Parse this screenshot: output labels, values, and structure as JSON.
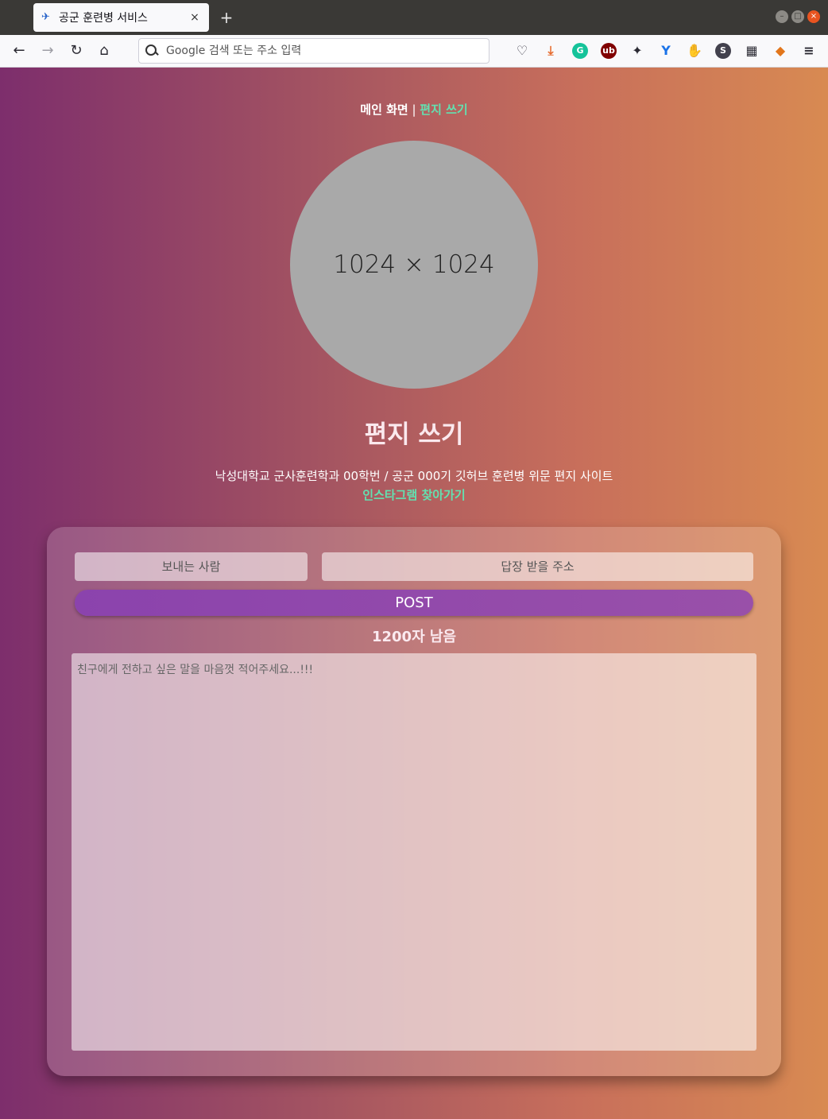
{
  "browser": {
    "tab_title": "공군 훈련병 서비스",
    "tab_close": "×",
    "new_tab": "+",
    "address_placeholder": "Google 검색 또는 주소 입력",
    "nav": {
      "back": "←",
      "forward": "→",
      "reload": "↻",
      "home": "⌂"
    },
    "extensions": [
      {
        "name": "pocket-icon",
        "label": "♡",
        "color": "#42414d"
      },
      {
        "name": "download-icon",
        "label": "⤓",
        "color": "#e66a2c"
      },
      {
        "name": "grammarly-icon",
        "label": "G",
        "color": "#15c39a"
      },
      {
        "name": "ublock-icon",
        "label": "ub",
        "color": "#800000"
      },
      {
        "name": "bee-icon",
        "label": "✦",
        "color": "#2b2a33"
      },
      {
        "name": "y-icon",
        "label": "Y",
        "color": "#1a73e8"
      },
      {
        "name": "gnome-icon",
        "label": "✋",
        "color": "#2b2a33"
      },
      {
        "name": "s-icon",
        "label": "S",
        "color": "#42414d"
      },
      {
        "name": "apps-icon",
        "label": "▦",
        "color": "#2b2a33"
      },
      {
        "name": "metamask-icon",
        "label": "◆",
        "color": "#e2761b"
      },
      {
        "name": "menu-icon",
        "label": "≡",
        "color": "#2b2a33"
      }
    ]
  },
  "page": {
    "nav_home": "메인 화면",
    "nav_sep": " | ",
    "nav_write": "편지 쓰기",
    "avatar_placeholder": "1024 × 1024",
    "title": "편지 쓰기",
    "subtitle": "낙성대학교 군사훈련학과 00학번 / 공군 000기 깃허브 훈련병 위문 편지 사이트",
    "instagram_link": "인스타그램 찾아가기"
  },
  "form": {
    "sender_placeholder": "보내는 사람",
    "reply_placeholder": "답장 받을 주소",
    "post_label": "POST",
    "counter": "1200자 남음",
    "letter_placeholder": "친구에게 전하고 싶은 말을 마음껏 적어주세요...!!!"
  }
}
